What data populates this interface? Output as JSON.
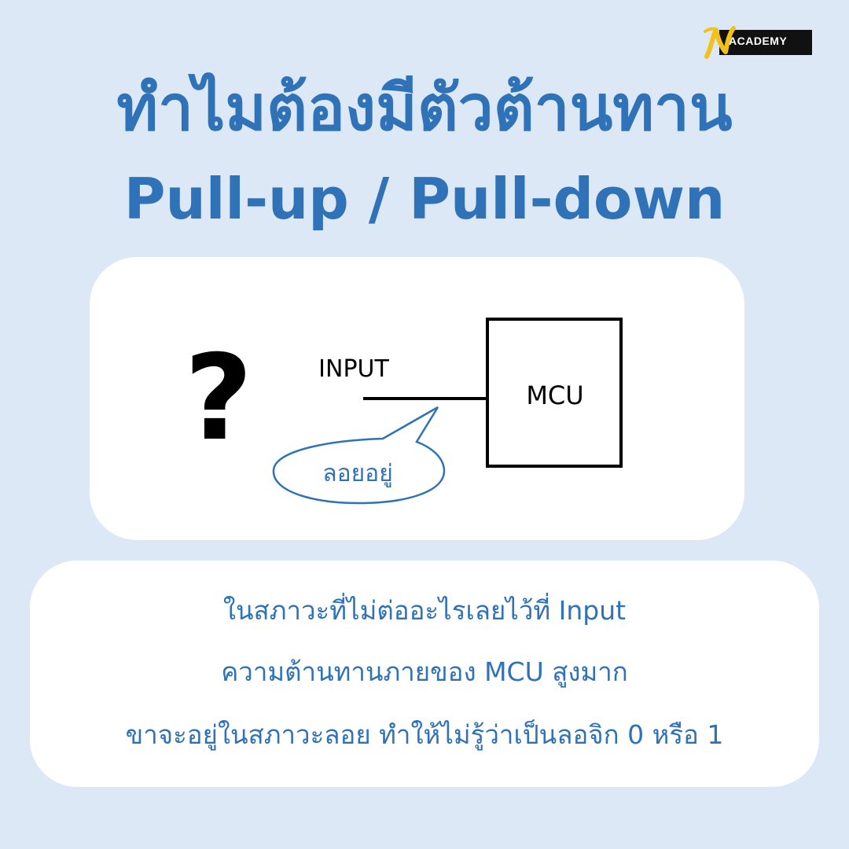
{
  "brand": {
    "logo_text": "ACADEMY",
    "logo_mark": "N",
    "colors": {
      "logo_mark": "#f2c11a",
      "logo_box": "#111111"
    }
  },
  "title": {
    "thai": "ทำไมต้องมีตัวต้านทาน",
    "english": "Pull-up / Pull-down"
  },
  "diagram": {
    "question_mark": "?",
    "input_label": "INPUT",
    "mcu_label": "MCU",
    "bubble_label": "ลอยอยู่"
  },
  "explanation": {
    "lines": [
      "ในสภาวะที่ไม่ต่ออะไรเลยไว้ที่ Input",
      "ความต้านทานภายของ MCU สูงมาก",
      "ขาจะอยู่ในสภาวะลอย ทำให้ไม่รู้ว่าเป็นลอจิก 0 หรือ 1"
    ]
  },
  "colors": {
    "background": "#dce8f6",
    "accent": "#2f72b7",
    "card": "#ffffff"
  }
}
